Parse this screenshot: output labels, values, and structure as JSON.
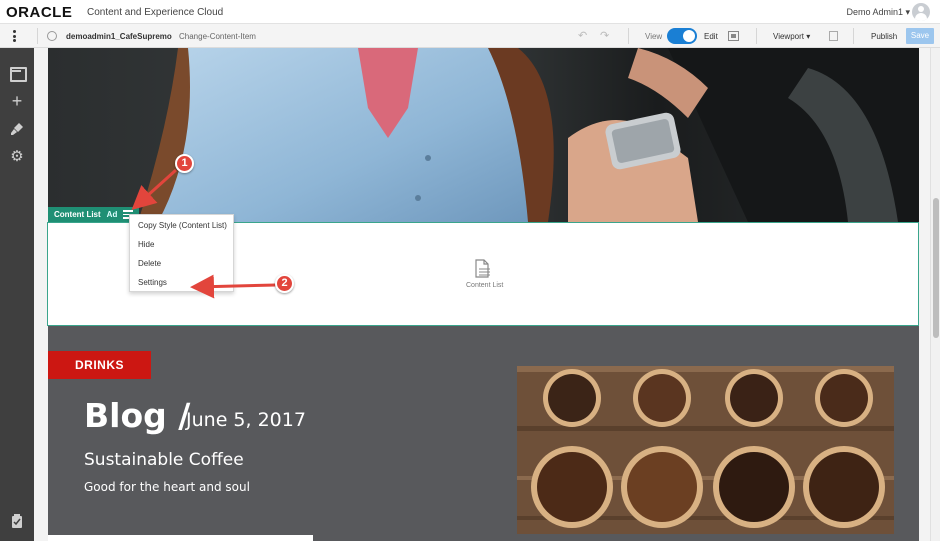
{
  "header": {
    "logo": "ORACLE",
    "product": "Content and Experience Cloud",
    "user": "Demo Admin1 ▾"
  },
  "toolbar": {
    "site_name": "demoadmin1_CafeSupremo",
    "page_name": "Change-Content-Item",
    "view_label": "View",
    "edit_label": "Edit",
    "viewport_label": "Viewport ▾",
    "publish_label": "Publish",
    "save_label": "Save",
    "edit_mode_on": true
  },
  "component": {
    "tag_label": "Content List",
    "tag_suffix": "Ad",
    "placeholder_label": "Content List"
  },
  "context_menu": {
    "items": [
      "Copy Style (Content List)",
      "Hide",
      "Delete",
      "Settings"
    ]
  },
  "callouts": [
    "1",
    "2"
  ],
  "blog": {
    "category": "DRINKS",
    "title": "Blog /",
    "date": "June 5, 2017",
    "subtitle": "Sustainable Coffee",
    "tagline": "Good for the heart and soul"
  },
  "colors": {
    "accent_blue": "#1a7fd4",
    "component_green": "#1f8f74",
    "callout_red": "#e2453c",
    "drinks_red": "#cc1712",
    "blog_bg": "#58595c",
    "rail_bg": "#3f3f3f"
  },
  "icons": {
    "rail": [
      "panels-icon",
      "add-icon",
      "brush-icon",
      "gear-icon",
      "clipboard-icon"
    ]
  }
}
